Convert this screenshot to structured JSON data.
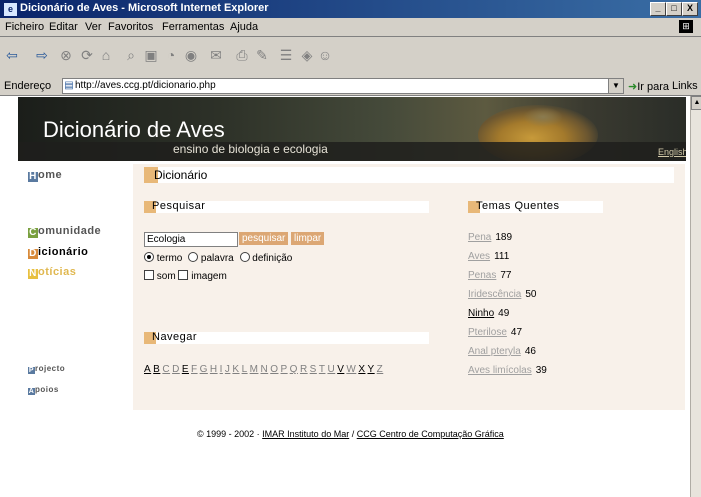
{
  "window": {
    "title": "Dicionário de Aves - Microsoft Internet Explorer",
    "buttons": [
      "_",
      "□",
      "X"
    ]
  },
  "menu": [
    "Ficheiro",
    "Editar",
    "Ver",
    "Favoritos",
    "Ferramentas",
    "Ajuda"
  ],
  "toolbar": {
    "icons": [
      "back-icon",
      "forward-icon",
      "stop-icon",
      "refresh-icon",
      "home-icon",
      "search-icon",
      "favorites-icon",
      "history-icon",
      "media-icon",
      "mail-icon",
      "print-icon",
      "edit-icon",
      "discuss-icon",
      "messenger-icon"
    ]
  },
  "address": {
    "label": "Endereço",
    "url": "http://aves.ccg.pt/dicionario.php",
    "go_label": "Ir para",
    "links_label": "Links"
  },
  "banner": {
    "title": "Dicionário de Aves",
    "subtitle": "ensino de biologia e ecologia",
    "english_link": "English"
  },
  "nav": {
    "home": {
      "initial": "H",
      "rest": "ome",
      "color": "#5a7aa0"
    },
    "comunidade": {
      "initial": "C",
      "rest": "omunidade",
      "color": "#7aa040"
    },
    "dicionario": {
      "initial": "D",
      "rest": "icionário",
      "color": "#d88a3a"
    },
    "noticias": {
      "initial": "N",
      "rest": "otícias",
      "color": "#e8c040"
    },
    "projecto": {
      "initial": "P",
      "rest": "rojecto",
      "color": "#5a7aa0"
    },
    "apoios": {
      "initial": "A",
      "rest": "poios",
      "color": "#5a7aa0"
    }
  },
  "content": {
    "page_title": "Dicionário",
    "search": {
      "heading": "Pesquisar",
      "value": "Ecologia",
      "search_button": "pesquisar",
      "clear_button": "limpar",
      "radio_options": [
        "termo",
        "palavra",
        "definição"
      ],
      "radio_selected": "termo",
      "check_options": [
        "som",
        "imagem"
      ]
    },
    "browse": {
      "heading": "Navegar",
      "letters": [
        "A",
        "B",
        "C",
        "D",
        "E",
        "F",
        "G",
        "H",
        "I",
        "J",
        "K",
        "L",
        "M",
        "N",
        "O",
        "P",
        "Q",
        "R",
        "S",
        "T",
        "U",
        "V",
        "W",
        "X",
        "Y",
        "Z"
      ]
    },
    "hot_topics": {
      "heading": "Temas Quentes",
      "items": [
        {
          "term": "Pena",
          "count": "189"
        },
        {
          "term": "Aves",
          "count": "111"
        },
        {
          "term": "Penas",
          "count": "77"
        },
        {
          "term": "Iridescência",
          "count": "50"
        },
        {
          "term": "Ninho",
          "count": "49"
        },
        {
          "term": "Pterilose",
          "count": "47"
        },
        {
          "term": "Anal pteryla",
          "count": "46"
        },
        {
          "term": "Aves limícolas",
          "count": "39"
        }
      ]
    }
  },
  "footer": {
    "copyright": "© 1999 - 2002 · ",
    "link1": "IMAR Instituto do Mar",
    "sep": " / ",
    "link2": "CCG Centro de Computação Gráfica"
  }
}
